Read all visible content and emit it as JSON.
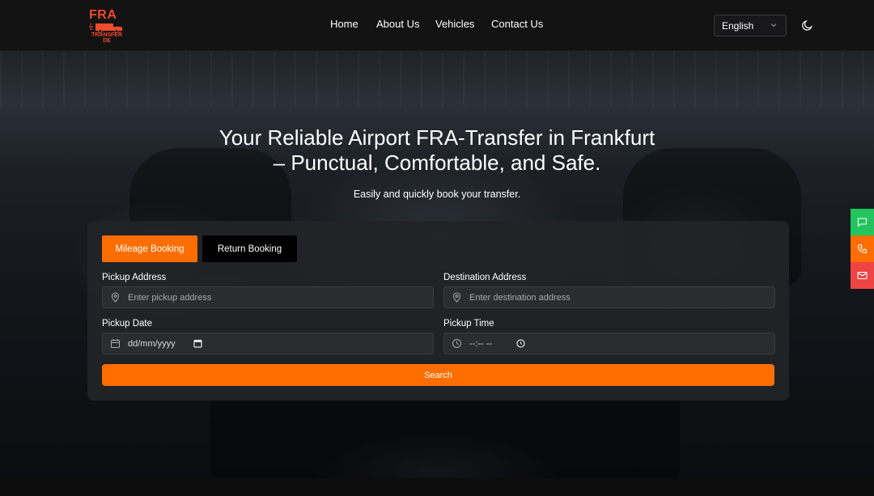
{
  "brand": {
    "logo_text": "FRA",
    "logo_sub": "TRANSFER DE",
    "color": "#ef4a2b"
  },
  "nav": {
    "items": [
      "Home",
      "About Us",
      "Vehicles",
      "Contact Us"
    ]
  },
  "language": {
    "selected": "English"
  },
  "theme_toggle_icon": "moon-icon",
  "hero": {
    "title_line1": "Your Reliable Airport FRA-Transfer in Frankfurt",
    "title_line2": "– Punctual, Comfortable, and Safe.",
    "subtitle": "Easily and quickly book your transfer."
  },
  "booking": {
    "tabs": [
      {
        "label": "Mileage Booking",
        "active": true
      },
      {
        "label": "Return Booking",
        "active": false
      }
    ],
    "pickup_address": {
      "label": "Pickup Address",
      "placeholder": "Enter pickup address",
      "icon": "map-pin-icon"
    },
    "destination_address": {
      "label": "Destination Address",
      "placeholder": "Enter destination address",
      "icon": "map-pin-icon"
    },
    "pickup_date": {
      "label": "Pickup Date",
      "value": "dd/mm/yyyy",
      "icon": "calendar-icon"
    },
    "pickup_time": {
      "label": "Pickup Time",
      "value": "--:-- --",
      "icon": "clock-icon"
    },
    "search_label": "Search"
  },
  "side_contacts": [
    {
      "icon": "chat-icon",
      "color": "#22c55e"
    },
    {
      "icon": "phone-icon",
      "color": "#fd6d00"
    },
    {
      "icon": "mail-icon",
      "color": "#ef4444"
    }
  ],
  "colors": {
    "accent": "#fd6d00",
    "background": "#121213",
    "card": "#222326"
  }
}
